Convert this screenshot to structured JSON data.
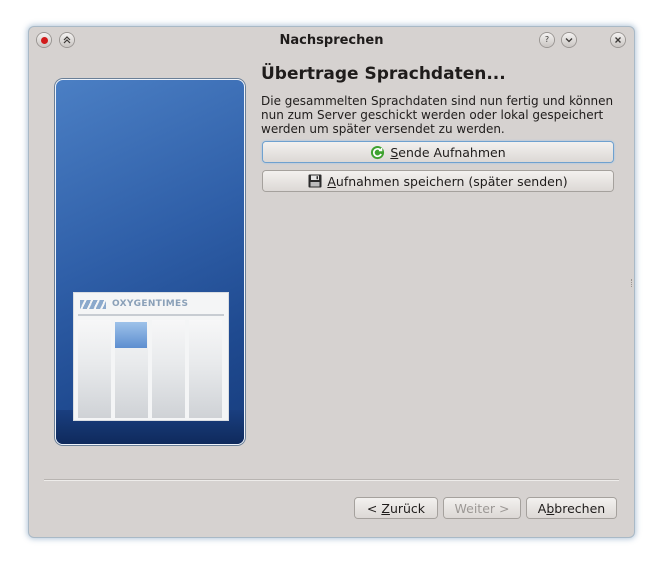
{
  "window": {
    "title": "Nachsprechen",
    "help_label": "?",
    "minimize_label": "˅",
    "close_label": "×",
    "keep_above_label": "⌃"
  },
  "sidebar": {
    "masthead": "OXYGENTIMES"
  },
  "page": {
    "heading": "Übertrage Sprachdaten...",
    "description": "Die gesammelten Sprachdaten sind nun fertig und können nun zum Server geschickt werden oder lokal gespeichert werden um später versendet zu werden.",
    "send_button": {
      "mnemonic": "S",
      "rest": "ende Aufnahmen"
    },
    "save_button": {
      "mnemonic": "A",
      "rest": "ufnahmen speichern (später senden)"
    }
  },
  "footer": {
    "back_pre": "< ",
    "back_mn": "Z",
    "back_rest": "urück",
    "next_label": "Weiter >",
    "cancel_pre": "A",
    "cancel_mn": "b",
    "cancel_rest": "brechen"
  },
  "colors": {
    "window_bg": "#d6d2d0",
    "sidebar_blue": "#2f5fa8",
    "focus_blue": "#6fa1cf",
    "send_icon_green": "#3fa230"
  },
  "icons": {
    "send": "green-refresh-icon",
    "save": "floppy-disk-icon",
    "record": "record-dot-icon"
  }
}
